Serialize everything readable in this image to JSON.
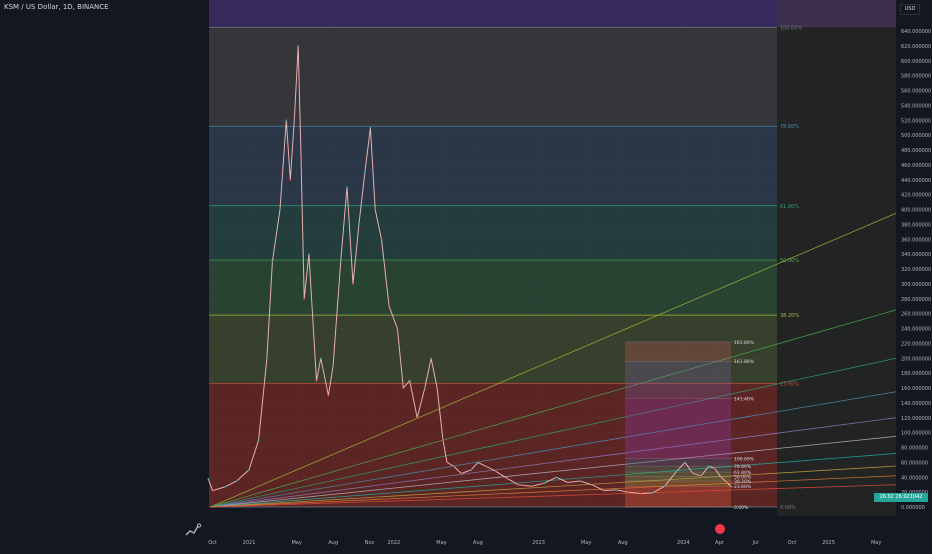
{
  "symbol": "KSM / US Dollar, 1D, BINANCE",
  "currency_button": "USD",
  "last_price_label": "26.92 26.921042",
  "timeline_badge": "icon: chart-event",
  "colors": {
    "background": "#131722",
    "up_candle": "#26a69a",
    "down_candle": "#ef5350",
    "grid": "#1e222d",
    "axis_text": "#b2b5be"
  },
  "fib_large": {
    "levels": [
      {
        "label": "100.00%",
        "price": 645,
        "fill": "rgba(120,110,100,0.35)",
        "line": "#787b86"
      },
      {
        "label": "78.60%",
        "price": 512,
        "fill": "rgba(100,130,160,0.30)",
        "line": "#4a90b8"
      },
      {
        "label": "61.80%",
        "price": 405,
        "fill": "rgba(70,150,120,0.30)",
        "line": "#2e9e7a"
      },
      {
        "label": "50.00%",
        "price": 332,
        "fill": "rgba(90,170,90,0.30)",
        "line": "#4caf50"
      },
      {
        "label": "38.20%",
        "price": 258,
        "fill": "rgba(140,160,70,0.30)",
        "line": "#9eb83c"
      },
      {
        "label": "23.60%",
        "price": 166,
        "fill": "rgba(200,60,40,0.40)",
        "line": "#e04b3a"
      },
      {
        "label": "0.00%",
        "price": 0,
        "fill": "rgba(120,120,120,0.20)",
        "line": "#787b86"
      }
    ]
  },
  "fib_small": {
    "levels": [
      {
        "label": "161.80%",
        "price": 222,
        "fill": "rgba(200,90,90,0.30)"
      },
      {
        "label": "161.80%",
        "price": 196,
        "fill": "rgba(120,100,160,0.30)"
      },
      {
        "label": "141.40%",
        "price": 146,
        "fill": "rgba(150,60,180,0.30)"
      },
      {
        "label": "100.00%",
        "price": 65,
        "fill": "rgba(60,100,150,0.30)"
      },
      {
        "label": "78.60%",
        "price": 55,
        "fill": "rgba(60,150,120,0.30)"
      },
      {
        "label": "61.80%",
        "price": 47,
        "fill": "rgba(80,170,90,0.30)"
      },
      {
        "label": "50.00%",
        "price": 41,
        "fill": "rgba(120,180,80,0.30)"
      },
      {
        "label": "38.20%",
        "price": 35,
        "fill": "rgba(180,170,60,0.30)"
      },
      {
        "label": "23.60%",
        "price": 28,
        "fill": "rgba(220,90,60,0.35)"
      },
      {
        "label": "0.00%",
        "price": 0,
        "fill": "rgba(120,120,120,0.20)"
      }
    ]
  },
  "chart_data": {
    "type": "line",
    "title": "KSM / US Dollar, 1D, BINANCE",
    "xlabel": "",
    "ylabel": "",
    "y_axis_ticks": [
      "0.000000",
      "20.000000",
      "40.000000",
      "60.000000",
      "80.000000",
      "100.000000",
      "120.000000",
      "140.000000",
      "160.000000",
      "180.000000",
      "200.000000",
      "220.000000",
      "240.000000",
      "260.000000",
      "280.000000",
      "300.000000",
      "320.000000",
      "340.000000",
      "360.000000",
      "380.000000",
      "400.000000",
      "420.000000",
      "440.000000",
      "460.000000",
      "480.000000",
      "500.000000",
      "520.000000",
      "540.000000",
      "560.000000",
      "580.000000",
      "600.000000",
      "620.000000",
      "640.000000"
    ],
    "y_axis_values": [
      0,
      20,
      40,
      60,
      80,
      100,
      120,
      140,
      160,
      180,
      200,
      220,
      240,
      260,
      280,
      300,
      320,
      340,
      360,
      380,
      400,
      420,
      440,
      460,
      480,
      500,
      520,
      540,
      560,
      580,
      600,
      620,
      640
    ],
    "ylim": [
      -16,
      660
    ],
    "x_axis_ticks": [
      "Oct",
      "2021",
      "May",
      "Aug",
      "Nov",
      "2022",
      "May",
      "Aug",
      "2023",
      "May",
      "Aug",
      "2024",
      "Apr",
      "Jul",
      "Oct",
      "2025",
      "May"
    ],
    "x_axis_dates": [
      "2020-10-01",
      "2021-01-01",
      "2021-05-01",
      "2021-08-01",
      "2021-11-01",
      "2022-01-01",
      "2022-05-01",
      "2022-08-01",
      "2023-01-01",
      "2023-05-01",
      "2023-08-01",
      "2024-01-01",
      "2024-04-01",
      "2024-07-01",
      "2024-10-01",
      "2025-01-01",
      "2025-05-01"
    ],
    "grid": true,
    "series": [
      {
        "points": [
          {
            "x": "2020-09-20",
            "y": 38
          },
          {
            "x": "2020-10-01",
            "y": 22
          },
          {
            "x": "2020-11-01",
            "y": 27
          },
          {
            "x": "2020-12-01",
            "y": 35
          },
          {
            "x": "2021-01-01",
            "y": 50
          },
          {
            "x": "2021-01-25",
            "y": 90
          },
          {
            "x": "2021-02-15",
            "y": 200
          },
          {
            "x": "2021-03-01",
            "y": 330
          },
          {
            "x": "2021-03-20",
            "y": 400
          },
          {
            "x": "2021-04-05",
            "y": 520
          },
          {
            "x": "2021-04-15",
            "y": 440
          },
          {
            "x": "2021-04-25",
            "y": 520
          },
          {
            "x": "2021-05-05",
            "y": 620
          },
          {
            "x": "2021-05-12",
            "y": 470
          },
          {
            "x": "2021-05-20",
            "y": 280
          },
          {
            "x": "2021-06-01",
            "y": 340
          },
          {
            "x": "2021-06-20",
            "y": 170
          },
          {
            "x": "2021-07-01",
            "y": 200
          },
          {
            "x": "2021-07-20",
            "y": 150
          },
          {
            "x": "2021-08-01",
            "y": 190
          },
          {
            "x": "2021-08-20",
            "y": 330
          },
          {
            "x": "2021-09-05",
            "y": 430
          },
          {
            "x": "2021-09-20",
            "y": 300
          },
          {
            "x": "2021-10-05",
            "y": 380
          },
          {
            "x": "2021-10-20",
            "y": 450
          },
          {
            "x": "2021-11-03",
            "y": 510
          },
          {
            "x": "2021-11-15",
            "y": 400
          },
          {
            "x": "2021-12-01",
            "y": 360
          },
          {
            "x": "2021-12-20",
            "y": 270
          },
          {
            "x": "2022-01-10",
            "y": 240
          },
          {
            "x": "2022-01-25",
            "y": 160
          },
          {
            "x": "2022-02-10",
            "y": 170
          },
          {
            "x": "2022-03-01",
            "y": 120
          },
          {
            "x": "2022-03-20",
            "y": 160
          },
          {
            "x": "2022-04-05",
            "y": 200
          },
          {
            "x": "2022-04-20",
            "y": 160
          },
          {
            "x": "2022-05-05",
            "y": 90
          },
          {
            "x": "2022-05-15",
            "y": 60
          },
          {
            "x": "2022-06-01",
            "y": 55
          },
          {
            "x": "2022-06-20",
            "y": 45
          },
          {
            "x": "2022-07-15",
            "y": 50
          },
          {
            "x": "2022-08-01",
            "y": 60
          },
          {
            "x": "2022-08-20",
            "y": 55
          },
          {
            "x": "2022-09-15",
            "y": 48
          },
          {
            "x": "2022-10-15",
            "y": 38
          },
          {
            "x": "2022-11-10",
            "y": 30
          },
          {
            "x": "2022-12-15",
            "y": 28
          },
          {
            "x": "2023-01-15",
            "y": 32
          },
          {
            "x": "2023-02-15",
            "y": 40
          },
          {
            "x": "2023-03-15",
            "y": 33
          },
          {
            "x": "2023-04-15",
            "y": 35
          },
          {
            "x": "2023-05-15",
            "y": 30
          },
          {
            "x": "2023-06-15",
            "y": 22
          },
          {
            "x": "2023-07-15",
            "y": 23
          },
          {
            "x": "2023-08-15",
            "y": 20
          },
          {
            "x": "2023-09-15",
            "y": 18
          },
          {
            "x": "2023-10-15",
            "y": 19
          },
          {
            "x": "2023-11-15",
            "y": 28
          },
          {
            "x": "2023-12-15",
            "y": 48
          },
          {
            "x": "2024-01-05",
            "y": 60
          },
          {
            "x": "2024-01-25",
            "y": 45
          },
          {
            "x": "2024-02-15",
            "y": 42
          },
          {
            "x": "2024-03-05",
            "y": 55
          },
          {
            "x": "2024-03-20",
            "y": 52
          },
          {
            "x": "2024-04-05",
            "y": 40
          },
          {
            "x": "2024-04-20",
            "y": 33
          },
          {
            "x": "2024-05-01",
            "y": 27
          }
        ]
      }
    ]
  }
}
